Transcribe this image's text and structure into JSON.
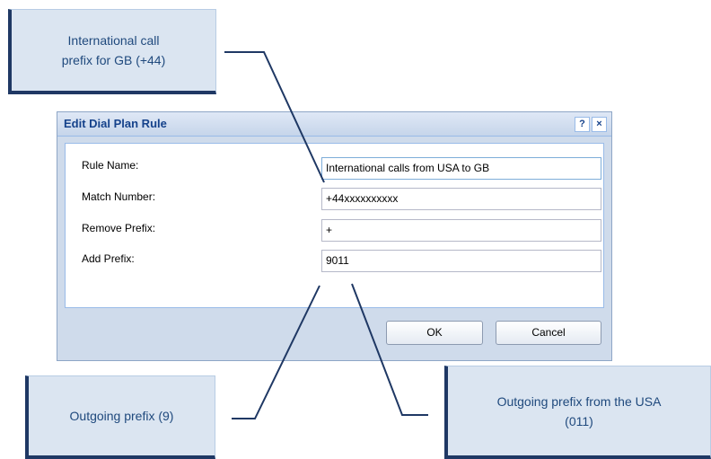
{
  "callouts": {
    "gb_line1": "International call",
    "gb_line2": "prefix for GB (+44)",
    "out9": "Outgoing prefix (9)",
    "usa_line1": "Outgoing prefix from the USA",
    "usa_line2": "(011)"
  },
  "dialog": {
    "title": "Edit Dial Plan Rule",
    "help_icon": "?",
    "close_icon": "×",
    "fields": [
      {
        "label": "Rule Name:",
        "value": "International calls from USA to GB"
      },
      {
        "label": "Match Number:",
        "value": "+44xxxxxxxxxx"
      },
      {
        "label": "Remove Prefix:",
        "value": "+"
      },
      {
        "label": "Add Prefix:",
        "value": "9011"
      }
    ],
    "ok_label": "OK",
    "cancel_label": "Cancel"
  },
  "colors": {
    "callout_bg": "#dbe5f1",
    "callout_border": "#1f3864",
    "dialog_bg": "#cfdbeb",
    "title_text": "#15428b"
  }
}
